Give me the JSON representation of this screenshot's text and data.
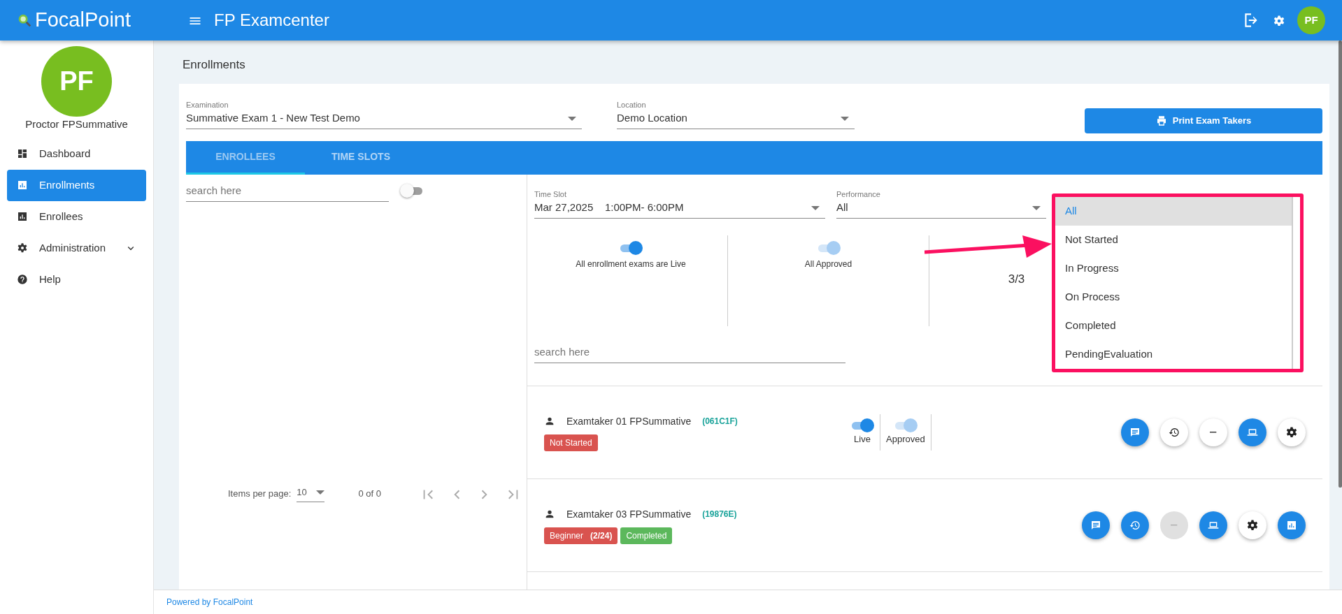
{
  "header": {
    "logo": "FocalPoint",
    "app_title": "FP Examcenter",
    "avatar": "PF"
  },
  "sidebar": {
    "avatar": "PF",
    "user_name": "Proctor FPSummative",
    "items": [
      {
        "label": "Dashboard",
        "kind": "dashboard",
        "selected": false
      },
      {
        "label": "Enrollments",
        "kind": "chart",
        "selected": true
      },
      {
        "label": "Enrollees",
        "kind": "chart",
        "selected": false
      },
      {
        "label": "Administration",
        "kind": "gear",
        "selected": false,
        "expanded": false
      },
      {
        "label": "Help",
        "kind": "help",
        "selected": false
      }
    ]
  },
  "page_title": "Enrollments",
  "filters": {
    "examination": {
      "label": "Examination",
      "value": "Summative Exam 1 - New Test Demo"
    },
    "location": {
      "label": "Location",
      "value": "Demo Location"
    },
    "print_button": "Print Exam Takers"
  },
  "tabs": [
    {
      "label": "ENROLLEES",
      "selected": true
    },
    {
      "label": "TIME SLOTS",
      "selected": false
    }
  ],
  "left_pane": {
    "search": {
      "placeholder": "search here"
    },
    "toggle": {
      "on": false
    },
    "pagination": {
      "label": "Items per page:",
      "page_size": "10",
      "range": "0 of 0"
    }
  },
  "right_pane": {
    "time_slot": {
      "label": "Time Slot",
      "value": "Mar 27,2025    1:00PM- 6:00PM"
    },
    "performance": {
      "label": "Performance",
      "value": "All",
      "options": [
        {
          "label": "All",
          "selected": true
        },
        {
          "label": "Not Started",
          "selected": false
        },
        {
          "label": "In Progress",
          "selected": false
        },
        {
          "label": "On Process",
          "selected": false
        },
        {
          "label": "Completed",
          "selected": false
        },
        {
          "label": "PendingEvaluation",
          "selected": false
        }
      ]
    },
    "summary": [
      {
        "label": "All enrollment exams are Live",
        "on": true,
        "disabled": false
      },
      {
        "label": "All Approved",
        "on": true,
        "disabled": true
      }
    ],
    "count": "3/3",
    "search": {
      "placeholder": "search here"
    },
    "enrollees": [
      {
        "name": "Examtaker 01 FPSummative",
        "code": "(061C1F)",
        "badges": [
          {
            "text": "Not Started",
            "color": "#d9534f"
          }
        ],
        "toggles": [
          {
            "label": "Live",
            "on": true,
            "disabled": false
          },
          {
            "label": "Approved",
            "on": true,
            "disabled": true
          }
        ],
        "actions": [
          {
            "kind": "chat",
            "highlighted": true,
            "disabled": false
          },
          {
            "kind": "restore",
            "highlighted": false,
            "disabled": false
          },
          {
            "kind": "minus",
            "highlighted": false,
            "disabled": false
          },
          {
            "kind": "laptop",
            "highlighted": true,
            "disabled": false
          },
          {
            "kind": "gear",
            "highlighted": false,
            "disabled": false
          }
        ]
      },
      {
        "name": "Examtaker 03 FPSummative",
        "code": "(19876E)",
        "badges": [
          {
            "text": "Beginner   **(2/24)**",
            "color": "#d9534f"
          },
          {
            "text": "Completed",
            "color": "#5cb85c"
          }
        ],
        "actions": [
          {
            "kind": "chat",
            "highlighted": true,
            "disabled": false
          },
          {
            "kind": "restore",
            "highlighted": true,
            "disabled": false
          },
          {
            "kind": "minus",
            "highlighted": false,
            "disabled": true
          },
          {
            "kind": "laptop",
            "highlighted": true,
            "disabled": false
          },
          {
            "kind": "gear",
            "highlighted": false,
            "disabled": false
          },
          {
            "kind": "chart",
            "highlighted": true,
            "disabled": false
          }
        ]
      }
    ]
  },
  "footer": "Powered by FocalPoint"
}
